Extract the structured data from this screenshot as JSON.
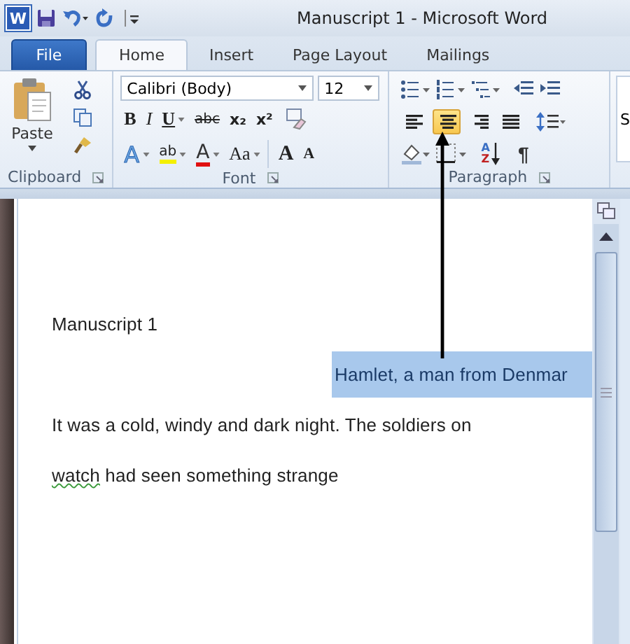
{
  "title_bar": {
    "logo": "W",
    "title": "Manuscript 1  -  Microsoft Word"
  },
  "tabs": [
    {
      "label": "File",
      "kind": "file",
      "selected": false
    },
    {
      "label": "Home",
      "kind": "tab",
      "selected": true
    },
    {
      "label": "Insert",
      "kind": "tab",
      "selected": false
    },
    {
      "label": "Page Layout",
      "kind": "tab",
      "selected": false
    },
    {
      "label": "Mailings",
      "kind": "tab",
      "selected": false
    }
  ],
  "clipboard": {
    "paste_label": "Paste",
    "group_label": "Clipboard"
  },
  "font": {
    "name": "Calibri (Body)",
    "size": "12",
    "group_label": "Font",
    "row_1": [
      {
        "kind": "bold",
        "label": "B"
      },
      {
        "kind": "italic",
        "label": "I"
      },
      {
        "kind": "underline",
        "label": "U"
      },
      {
        "kind": "strike",
        "label": "abc"
      },
      {
        "kind": "sub",
        "label": "x₂"
      },
      {
        "kind": "sup",
        "label": "x²"
      }
    ],
    "row_2": [
      {
        "kind": "effects",
        "label": "A"
      },
      {
        "kind": "highlight",
        "label": "ab"
      },
      {
        "kind": "color",
        "label": "A"
      },
      {
        "kind": "case",
        "label": "Aa"
      },
      {
        "kind": "grow",
        "label": "A"
      },
      {
        "kind": "shrink",
        "label": "A"
      }
    ]
  },
  "paragraph": {
    "group_label": "Paragraph",
    "alignment": [
      {
        "kind": "left",
        "selected": false
      },
      {
        "kind": "center",
        "selected": true
      },
      {
        "kind": "right",
        "selected": false
      },
      {
        "kind": "justify",
        "selected": false
      }
    ],
    "sort": {
      "top": "A",
      "bottom": "Z"
    },
    "marks": "¶"
  },
  "styles_partial": "S",
  "pointer_arrow": true,
  "document": {
    "lines": [
      {
        "kind": "left",
        "selected": false,
        "segments": [
          {
            "text": "Manuscript 1",
            "spelling_error": false
          }
        ]
      },
      {
        "kind": "center",
        "selected": true,
        "segments": [
          {
            "text": "Hamlet, a man from Denmar",
            "spelling_error": false
          }
        ]
      },
      {
        "kind": "left",
        "selected": false,
        "segments": [
          {
            "text": "It was a cold, windy and dark night. The soldiers on",
            "spelling_error": false
          }
        ]
      },
      {
        "kind": "left",
        "selected": false,
        "segments": [
          {
            "text": "watch",
            "spelling_error": true
          },
          {
            "text": " had seen something strange",
            "spelling_error": false
          }
        ]
      }
    ]
  }
}
